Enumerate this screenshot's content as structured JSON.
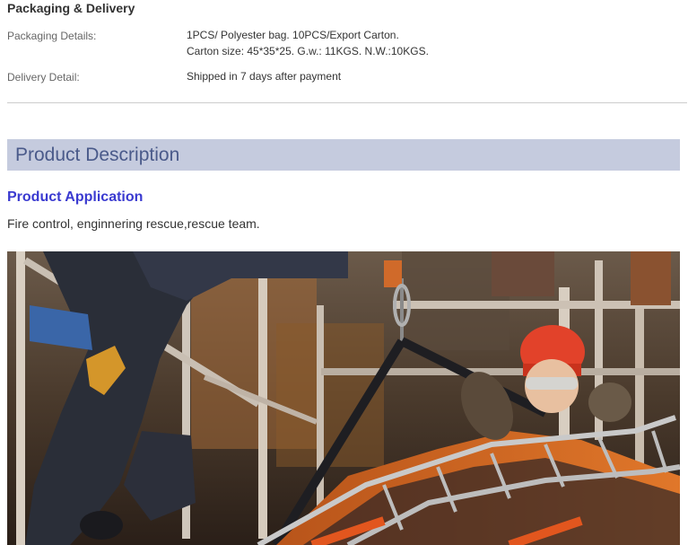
{
  "packaging": {
    "section_title": "Packaging & Delivery",
    "packaging_label": "Packaging Details:",
    "packaging_line1": "1PCS/ Polyester bag. 10PCS/Export Carton.",
    "packaging_line2": "Carton size: 45*35*25. G.w.: 11KGS. N.W.:10KGS.",
    "delivery_label": "Delivery Detail:",
    "delivery_value": "Shipped in 7 days after payment"
  },
  "description": {
    "bar_title": "Product Description",
    "application_heading": "Product Application",
    "application_text": "Fire control, enginnering rescue,rescue team."
  },
  "colors": {
    "bar_background": "#c5cbde",
    "bar_text": "#4a5a8a",
    "heading_blue": "#3a3ad0"
  },
  "photo": {
    "icon": "rescue-photo"
  }
}
